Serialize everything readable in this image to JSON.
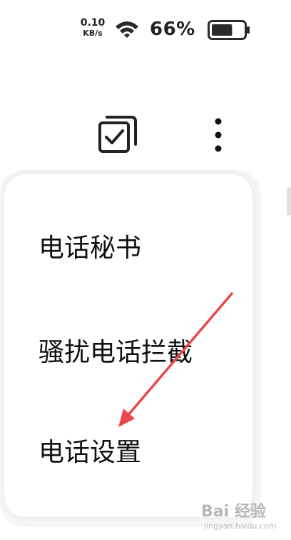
{
  "status_bar": {
    "net_speed_value": "0.10",
    "net_speed_unit": "KB/s",
    "battery_percent": "66%",
    "battery_level": 0.66,
    "wifi_icon": "wifi-icon",
    "battery_icon": "battery-icon"
  },
  "toolbar": {
    "select_icon": "multi-select-icon",
    "more_icon": "more-vertical-icon"
  },
  "menu": {
    "items": [
      {
        "label": "电话秘书"
      },
      {
        "label": "骚扰电话拦截"
      },
      {
        "label": "电话设置"
      }
    ]
  },
  "annotation": {
    "arrow_color": "#e8474b"
  },
  "watermark": {
    "brand": "Bai 经验",
    "sub": "jingyan.baidu.com"
  }
}
